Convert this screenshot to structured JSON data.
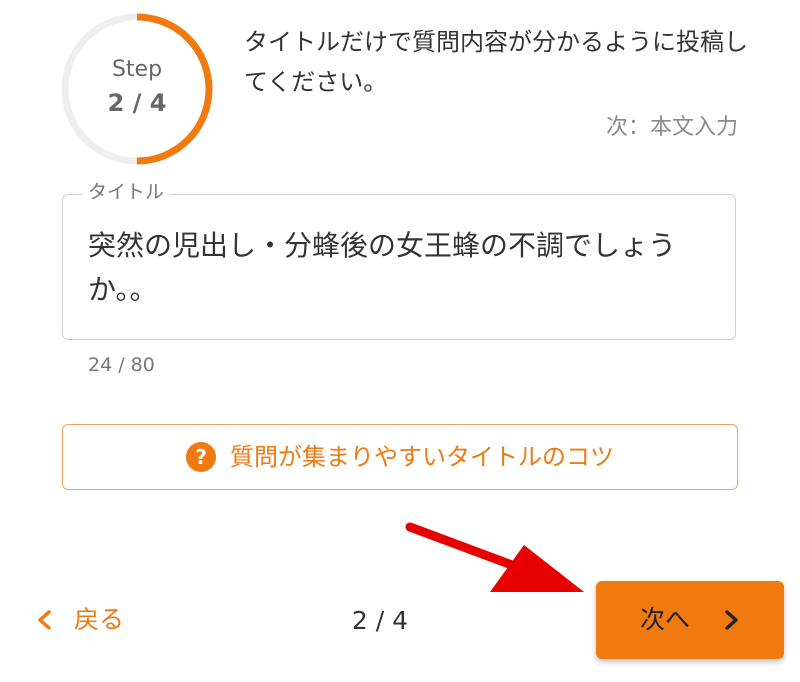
{
  "progress": {
    "step_label": "Step",
    "step_count": "2 / 4",
    "fraction": 0.5,
    "accent_color": "#f07a10",
    "track_color": "#eeeeee"
  },
  "instruction": "タイトルだけで質問内容が分かるように投稿してください。",
  "next_hint": "次：本文入力",
  "title_field": {
    "legend": "タイトル",
    "value": "突然の児出し・分蜂後の女王蜂の不調でしょうか。。",
    "char_count": "24 / 80"
  },
  "tips_button": {
    "icon": "question-circle-icon",
    "label": "質問が集まりやすいタイトルのコツ"
  },
  "annotation": {
    "icon": "red-arrow-icon",
    "color": "#e60000"
  },
  "footer": {
    "back_icon": "chevron-left-icon",
    "back_label": "戻る",
    "page_indicator": "2 / 4",
    "next_label": "次へ",
    "next_icon": "chevron-right-icon"
  }
}
